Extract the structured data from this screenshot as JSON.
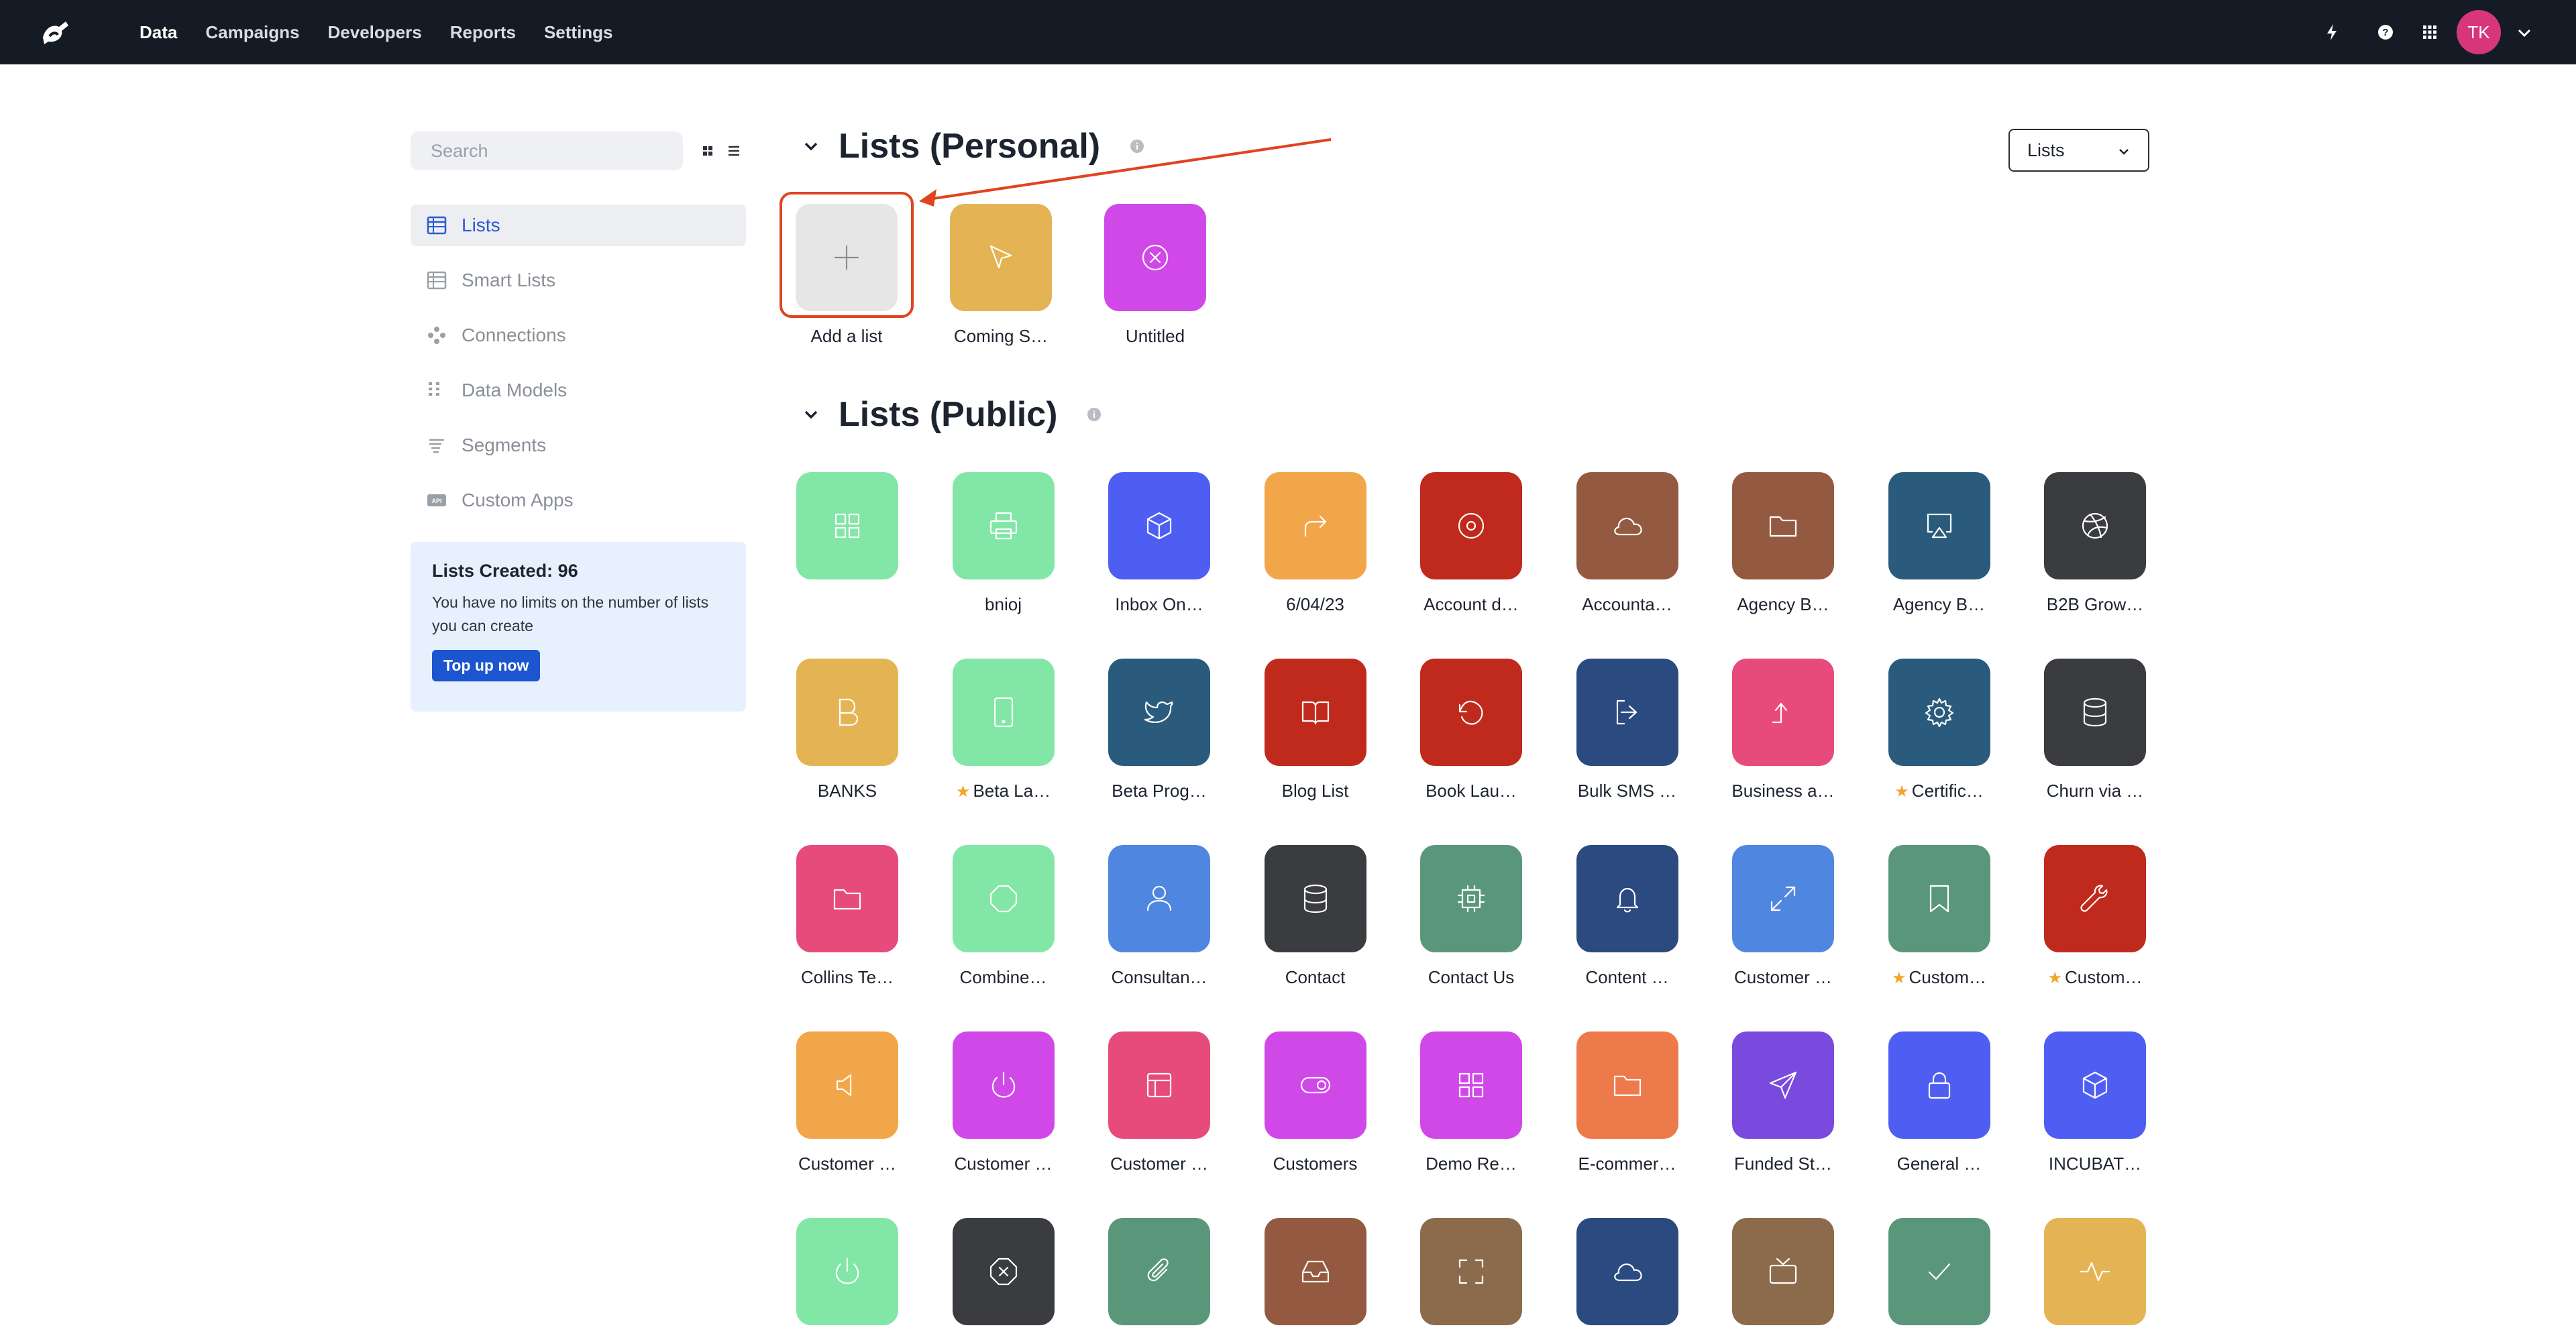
{
  "topnav": {
    "items": [
      {
        "label": "Data",
        "active": true
      },
      {
        "label": "Campaigns",
        "active": false
      },
      {
        "label": "Developers",
        "active": false
      },
      {
        "label": "Reports",
        "active": false
      },
      {
        "label": "Settings",
        "active": false
      }
    ],
    "icons": [
      "lightning-icon",
      "help-icon",
      "apps-grid-icon"
    ],
    "avatar_initials": "TK"
  },
  "sidebar": {
    "search_placeholder": "Search",
    "items": [
      {
        "label": "Lists",
        "icon": "table-icon",
        "active": true
      },
      {
        "label": "Smart Lists",
        "icon": "table-icon",
        "active": false
      },
      {
        "label": "Connections",
        "icon": "connections-icon",
        "active": false
      },
      {
        "label": "Data Models",
        "icon": "data-models-icon",
        "active": false
      },
      {
        "label": "Segments",
        "icon": "segments-icon",
        "active": false
      },
      {
        "label": "Custom Apps",
        "icon": "api-icon",
        "active": false
      }
    ],
    "info": {
      "title": "Lists Created: 96",
      "description": "You have no limits on the number of lists you can create",
      "button": "Top up now"
    }
  },
  "main": {
    "dropdown_value": "Lists",
    "personal": {
      "title": "Lists (Personal)",
      "tiles": [
        {
          "label": "Add a list",
          "color": "#e6e6e6",
          "icon": "plus-icon"
        },
        {
          "label": "Coming S…",
          "color": "#e4b454",
          "icon": "cursor-icon"
        },
        {
          "label": "Untitled",
          "color": "#d048e8",
          "icon": "x-circle-icon"
        }
      ]
    },
    "public": {
      "title": "Lists (Public)",
      "tiles": [
        {
          "label": "",
          "color": "#82e6a6",
          "icon": "grid-icon"
        },
        {
          "label": "bnioj",
          "color": "#82e6a6",
          "icon": "printer-icon"
        },
        {
          "label": "Inbox On…",
          "color": "#4f5ef2",
          "icon": "box-icon"
        },
        {
          "label": "6/04/23",
          "color": "#f2a64a",
          "icon": "share-arrow-icon"
        },
        {
          "label": "Account d…",
          "color": "#c02a1c",
          "icon": "target-icon"
        },
        {
          "label": "Accounta…",
          "color": "#945a41",
          "icon": "cloud-icon"
        },
        {
          "label": "Agency B…",
          "color": "#945a41",
          "icon": "folder-icon"
        },
        {
          "label": "Agency B…",
          "color": "#2a5b7c",
          "icon": "airplay-icon"
        },
        {
          "label": "B2B Grow…",
          "color": "#3a3c3f",
          "icon": "dribbble-icon"
        },
        {
          "label": "BANKS",
          "color": "#e4b454",
          "icon": "letter-b-icon"
        },
        {
          "label": "Beta La…",
          "color": "#82e6a6",
          "icon": "tablet-icon",
          "starred": true
        },
        {
          "label": "Beta Prog…",
          "color": "#2a5b7c",
          "icon": "twitter-icon"
        },
        {
          "label": "Blog List",
          "color": "#c02a1c",
          "icon": "book-icon"
        },
        {
          "label": "Book Lau…",
          "color": "#c02a1c",
          "icon": "rotate-icon"
        },
        {
          "label": "Bulk SMS …",
          "color": "#2a4a80",
          "icon": "logout-icon"
        },
        {
          "label": "Business a…",
          "color": "#e64b7c",
          "icon": "corner-up-icon"
        },
        {
          "label": "Certific…",
          "color": "#2a5b7c",
          "icon": "gear-icon",
          "starred": true
        },
        {
          "label": "Churn via …",
          "color": "#3a3c3f",
          "icon": "database-icon"
        },
        {
          "label": "Collins Te…",
          "color": "#e64b7c",
          "icon": "folder-icon"
        },
        {
          "label": "Combine…",
          "color": "#82e6a6",
          "icon": "octagon-icon"
        },
        {
          "label": "Consultan…",
          "color": "#4f86e0",
          "icon": "user-icon"
        },
        {
          "label": "Contact",
          "color": "#3a3c3f",
          "icon": "database-icon"
        },
        {
          "label": "Contact Us",
          "color": "#5a977a",
          "icon": "cpu-icon"
        },
        {
          "label": "Content …",
          "color": "#2a4a80",
          "icon": "bell-icon"
        },
        {
          "label": "Customer …",
          "color": "#4f86e0",
          "icon": "maximize-icon"
        },
        {
          "label": "Custom…",
          "color": "#5a977a",
          "icon": "bookmark-icon",
          "starred": true
        },
        {
          "label": "Custom…",
          "color": "#c02a1c",
          "icon": "wrench-icon",
          "starred": true
        },
        {
          "label": "Customer …",
          "color": "#f2a64a",
          "icon": "speaker-icon"
        },
        {
          "label": "Customer …",
          "color": "#d048e8",
          "icon": "power-icon"
        },
        {
          "label": "Customer …",
          "color": "#e64b7c",
          "icon": "layout-icon"
        },
        {
          "label": "Customers",
          "color": "#d048e8",
          "icon": "toggle-icon"
        },
        {
          "label": "Demo Re…",
          "color": "#d048e8",
          "icon": "grid-icon"
        },
        {
          "label": "E-commer…",
          "color": "#ec7a4a",
          "icon": "folder-icon"
        },
        {
          "label": "Funded St…",
          "color": "#7a4ade",
          "icon": "send-icon"
        },
        {
          "label": "General …",
          "color": "#4f5ef2",
          "icon": "lock-icon"
        },
        {
          "label": "INCUBAT…",
          "color": "#4f5ef2",
          "icon": "box-icon"
        },
        {
          "label": "",
          "color": "#82e6a6",
          "icon": "power-icon"
        },
        {
          "label": "",
          "color": "#3a3c3f",
          "icon": "x-octagon-icon"
        },
        {
          "label": "",
          "color": "#5a977a",
          "icon": "paperclip-icon"
        },
        {
          "label": "",
          "color": "#945a41",
          "icon": "inbox-icon"
        },
        {
          "label": "",
          "color": "#8c6a4c",
          "icon": "scan-icon"
        },
        {
          "label": "",
          "color": "#2a4a80",
          "icon": "cloud-icon"
        },
        {
          "label": "",
          "color": "#8c6a4c",
          "icon": "tv-icon"
        },
        {
          "label": "",
          "color": "#5a977a",
          "icon": "check-icon"
        },
        {
          "label": "",
          "color": "#e4b454",
          "icon": "activity-icon"
        }
      ]
    }
  }
}
